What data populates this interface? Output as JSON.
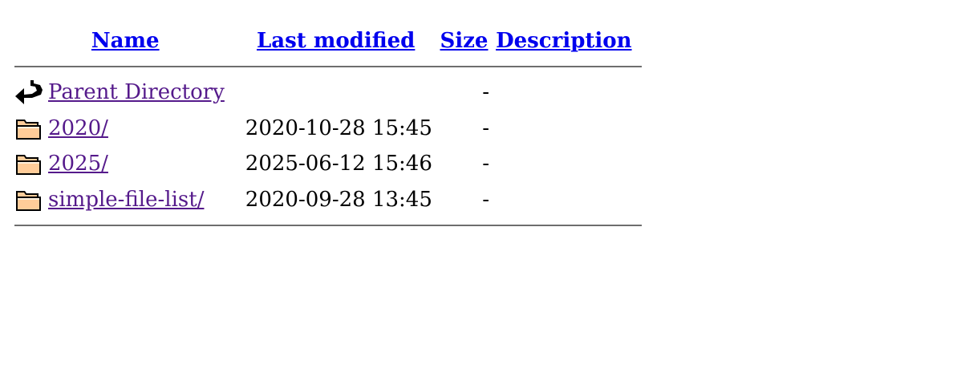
{
  "header": {
    "name": "Name",
    "last_modified": "Last modified",
    "size": "Size",
    "description": "Description"
  },
  "rows": [
    {
      "icon": "back-arrow-icon",
      "name": "Parent Directory",
      "modified": "",
      "size": "-",
      "description": ""
    },
    {
      "icon": "folder-icon",
      "name": "2020/",
      "modified": "2020-10-28 15:45",
      "size": "-",
      "description": ""
    },
    {
      "icon": "folder-icon",
      "name": "2025/",
      "modified": "2025-06-12 15:46",
      "size": "-",
      "description": ""
    },
    {
      "icon": "folder-icon",
      "name": "simple-file-list/",
      "modified": "2020-09-28 13:45",
      "size": "-",
      "description": ""
    }
  ],
  "colors": {
    "header_link": "#0000ee",
    "visited_link": "#551a8b",
    "rule": "#6e6e6e",
    "folder_fill": "#ffcc99"
  }
}
